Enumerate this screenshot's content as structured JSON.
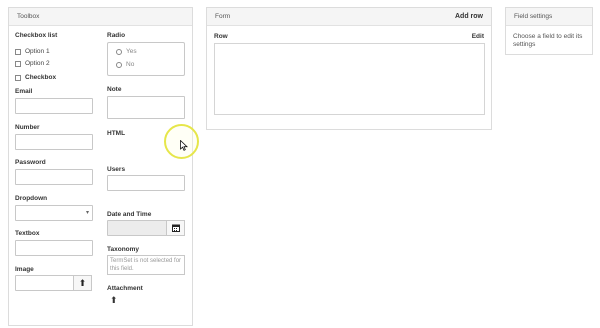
{
  "toolbox": {
    "title": "Toolbox",
    "checkbox_list": {
      "label": "Checkbox list",
      "options": [
        "Option 1",
        "Option 2"
      ]
    },
    "checkbox": {
      "label": "Checkbox"
    },
    "email": {
      "label": "Email",
      "value": ""
    },
    "number": {
      "label": "Number",
      "value": ""
    },
    "password": {
      "label": "Password",
      "value": ""
    },
    "dropdown": {
      "label": "Dropdown",
      "value": ""
    },
    "textbox": {
      "label": "Textbox",
      "value": ""
    },
    "image": {
      "label": "Image",
      "value": "",
      "icon": "upload-icon"
    },
    "radio": {
      "label": "Radio",
      "options": [
        "Yes",
        "No"
      ]
    },
    "note": {
      "label": "Note",
      "value": ""
    },
    "html": {
      "label": "HTML"
    },
    "users": {
      "label": "Users",
      "value": ""
    },
    "date_time": {
      "label": "Date and Time",
      "value": "",
      "icon": "calendar-icon"
    },
    "taxonomy": {
      "label": "Taxonomy",
      "message": "TermSet is not selected for this field."
    },
    "attachment": {
      "label": "Attachment",
      "icon": "upload-icon"
    }
  },
  "form": {
    "title": "Form",
    "add_row": "Add row",
    "row_label": "Row",
    "edit": "Edit"
  },
  "settings": {
    "title": "Field settings",
    "message": "Choose a field to edit its settings"
  },
  "colors": {
    "cursor_highlight": "#e6e64a",
    "panel_header": "#f5f5f5",
    "border": "#dcdcdc"
  }
}
